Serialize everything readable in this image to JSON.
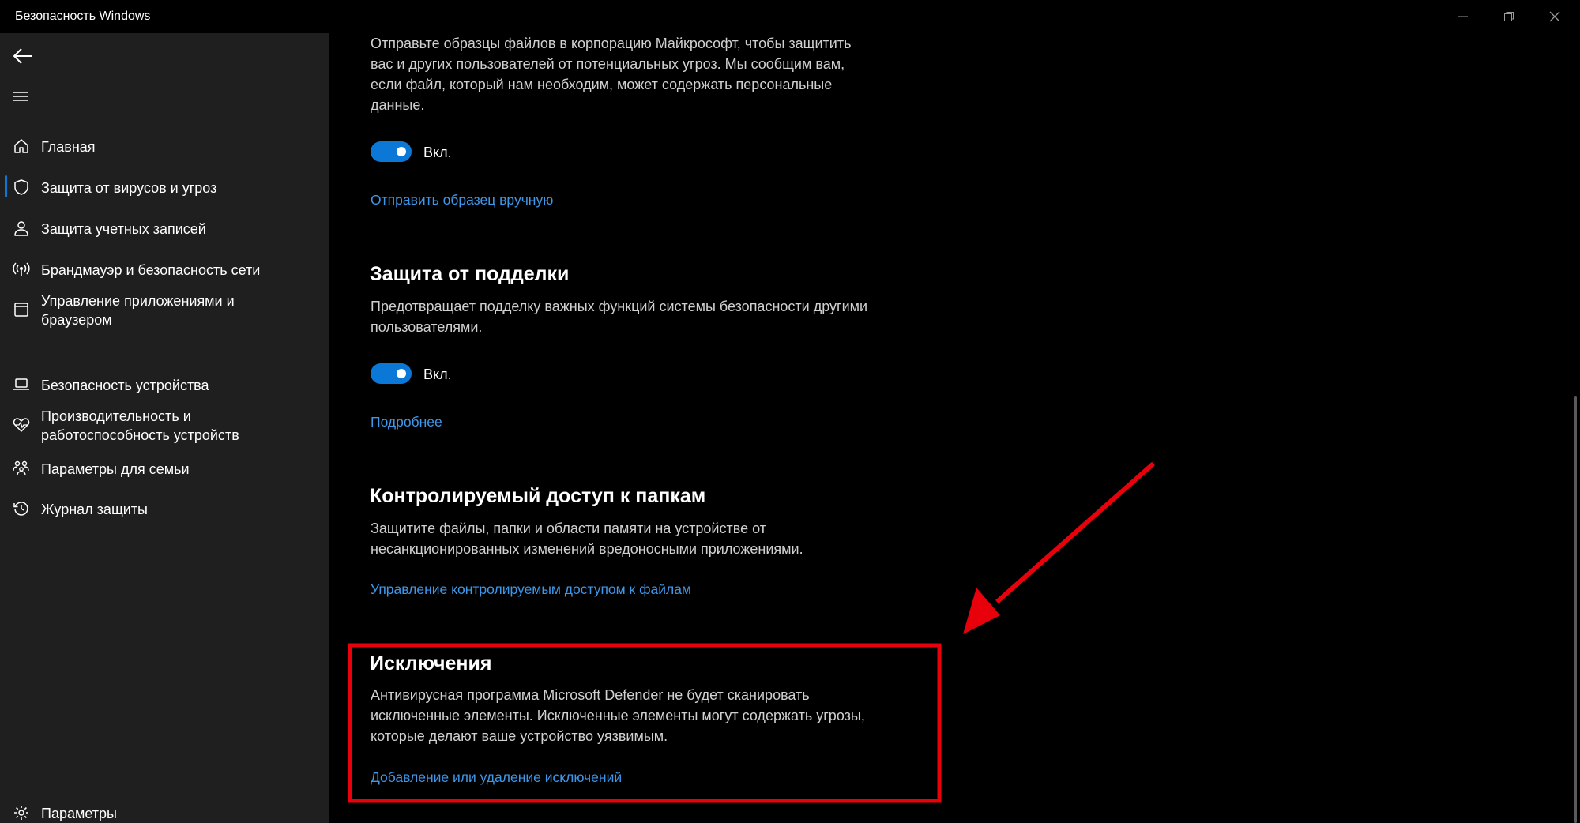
{
  "window": {
    "title": "Безопасность Windows"
  },
  "sidebar": {
    "items": [
      {
        "label": "Главная",
        "icon": "home-icon"
      },
      {
        "label": "Защита от вирусов и угроз",
        "icon": "shield-icon",
        "selected": true
      },
      {
        "label": "Защита учетных записей",
        "icon": "person-icon"
      },
      {
        "label": "Брандмауэр и безопасность сети",
        "icon": "wireless-icon"
      },
      {
        "label": "Управление приложениями и браузером",
        "icon": "app-window-icon"
      },
      {
        "label": "Безопасность устройства",
        "icon": "laptop-icon"
      },
      {
        "label": "Производительность и работоспособность устройств",
        "icon": "heart-pulse-icon"
      },
      {
        "label": "Параметры для семьи",
        "icon": "family-icon"
      },
      {
        "label": "Журнал защиты",
        "icon": "history-icon"
      }
    ],
    "settings_label": "Параметры"
  },
  "main": {
    "sample": {
      "description": "Отправьте образцы файлов в корпорацию Майкрософт, чтобы защитить вас и других пользователей от потенциальных угроз. Мы сообщим вам, если файл, который нам необходим, может содержать персональные данные.",
      "toggle_state": "Вкл.",
      "toggle_on": true,
      "link": "Отправить образец вручную"
    },
    "tamper": {
      "title": "Защита от подделки",
      "description": "Предотвращает подделку важных функций системы безопасности другими пользователями.",
      "toggle_state": "Вкл.",
      "toggle_on": true,
      "link": "Подробнее"
    },
    "folder_access": {
      "title": "Контролируемый доступ к папкам",
      "description": "Защитите файлы, папки и области памяти на устройстве от несанкционированных изменений вредоносными приложениями.",
      "link": "Управление контролируемым доступом к файлам"
    },
    "exclusions": {
      "title": "Исключения",
      "description": "Антивирусная программа Microsoft Defender не будет сканировать исключенные элементы. Исключенные элементы могут содержать угрозы, которые делают ваше устройство уязвимым.",
      "link": "Добавление или удаление исключений"
    }
  },
  "colors": {
    "accent": "#0b78d7",
    "link": "#3f97ea",
    "annotation": "#e8000b",
    "sidebar_bg": "#1f1f1f"
  }
}
